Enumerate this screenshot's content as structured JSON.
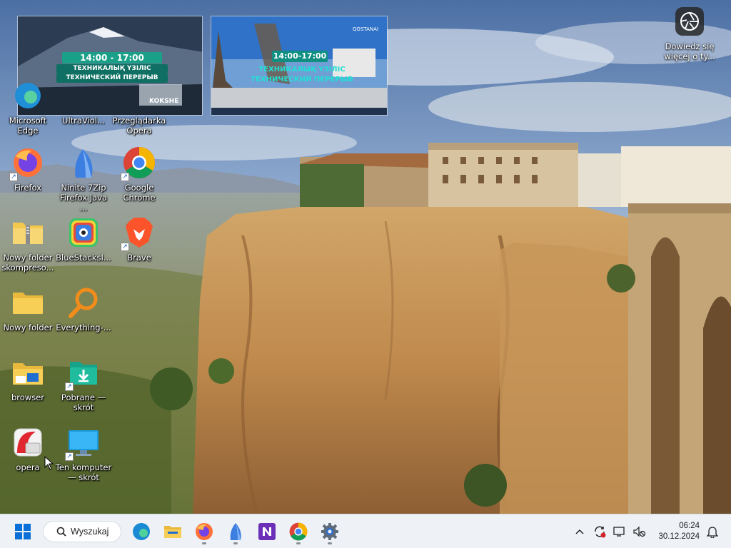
{
  "desktop": {
    "icons": [
      {
        "id": "edge",
        "label": "Microsoft\nEdge"
      },
      {
        "id": "ultraviolet",
        "label": "UltraViol..."
      },
      {
        "id": "opera-private",
        "label": "Przeglądarka\nOpera"
      },
      {
        "id": "firefox",
        "label": "Firefox"
      },
      {
        "id": "ninite",
        "label": "Ninite 7Zip\nFirefox Java ..."
      },
      {
        "id": "chrome",
        "label": "Google\nChrome"
      },
      {
        "id": "zip-folder",
        "label": "Nowy folder\nskompreso..."
      },
      {
        "id": "bluestacks",
        "label": "BlueStacksI..."
      },
      {
        "id": "brave",
        "label": "Brave"
      },
      {
        "id": "new-folder",
        "label": "Nowy folder"
      },
      {
        "id": "everything",
        "label": "Everything-..."
      },
      {
        "id": "browser",
        "label": "browser"
      },
      {
        "id": "downloads",
        "label": "Pobrane —\nskrót"
      },
      {
        "id": "opera",
        "label": "opera"
      },
      {
        "id": "this-pc",
        "label": "Ten komputer\n— skrót"
      }
    ]
  },
  "thumbnails": [
    {
      "id": "thumb-1",
      "time": "14:00 - 17:00",
      "line1": "ТЕХНИКАЛЫҚ ҮЗІЛІС",
      "line2": "ТЕХНИЧЕСКИЙ ПЕРЕРЫВ",
      "brand": "KOKSHE"
    },
    {
      "id": "thumb-2",
      "time": "14:00-17:00",
      "line1": "ТЕХНИКАЛЫҚ ҮЗІЛІС",
      "line2": "ТЕХНИЧЕСКИЙ ПЕРЕРЫВ",
      "brand": "QOSTANAI"
    }
  ],
  "spotlight": {
    "text": "Dowiedz się\nwięcej o ty..."
  },
  "taskbar": {
    "search_label": "Wyszukaj",
    "pinned": [
      "start-icon",
      "edge-icon",
      "file-explorer-icon",
      "firefox-icon",
      "ninite-icon",
      "onenote-icon",
      "chrome-icon",
      "settings-icon"
    ],
    "clock_time": "06:24",
    "clock_date": "30.12.2024"
  },
  "colors": {
    "taskbar_bg": "#eef2f7",
    "accent": "#0067c0"
  }
}
